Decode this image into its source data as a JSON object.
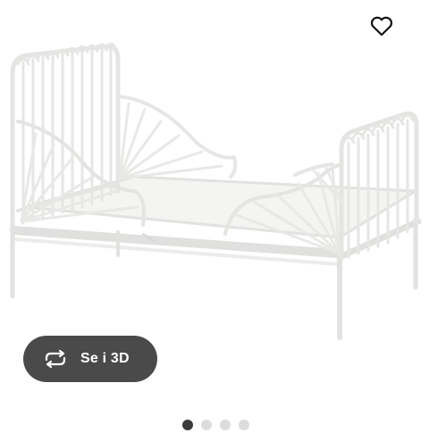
{
  "gallery": {
    "image_alt": "",
    "wishlist_icon": "heart-outline-icon",
    "view_3d": {
      "icon": "rotate-3d-icon",
      "label": "Se i 3D"
    },
    "pagination": {
      "total": 4,
      "active": 1
    }
  },
  "colors": {
    "background": "#ffffff",
    "button_bg": "#4a4a4a",
    "button_text": "#ffffff",
    "dot_active": "#3a3a3a",
    "dot_inactive": "#dcdcdc"
  }
}
